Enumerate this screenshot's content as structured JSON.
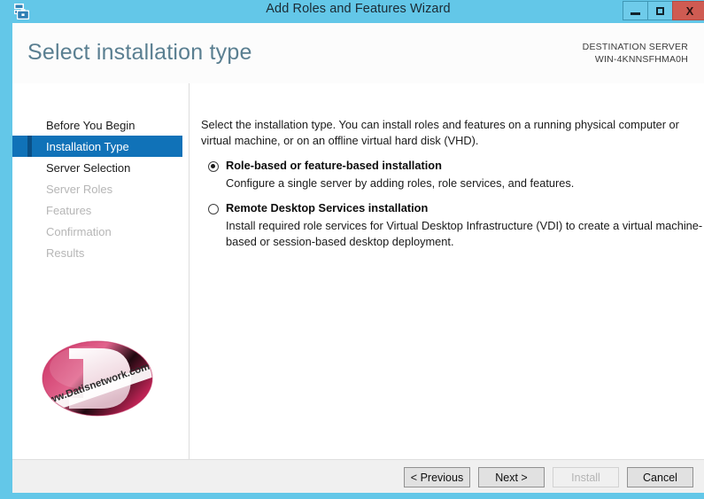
{
  "window": {
    "title": "Add Roles and Features Wizard",
    "app_icon": "server-manager-toolbox-icon",
    "minimize_label": "",
    "maximize_label": "",
    "close_label": "X",
    "frame_color": "#63c7e8",
    "close_color": "#cf5b52"
  },
  "header": {
    "page_title": "Select installation type",
    "destination_label": "DESTINATION SERVER",
    "destination_server": "WIN-4KNNSFHMA0H"
  },
  "sidebar": {
    "accent_color": "#1072b8",
    "items": [
      {
        "label": "Before You Begin",
        "state": "enabled"
      },
      {
        "label": "Installation Type",
        "state": "selected"
      },
      {
        "label": "Server Selection",
        "state": "enabled"
      },
      {
        "label": "Server Roles",
        "state": "disabled"
      },
      {
        "label": "Features",
        "state": "disabled"
      },
      {
        "label": "Confirmation",
        "state": "disabled"
      },
      {
        "label": "Results",
        "state": "disabled"
      }
    ],
    "logo": {
      "name": "datisnetwork-logo",
      "letter": "D",
      "banner_text": "www.Datisnetwork.com",
      "color": "#d6386b"
    }
  },
  "main": {
    "intro": "Select the installation type. You can install roles and features on a running physical computer or virtual machine, or on an offline virtual hard disk (VHD).",
    "options": [
      {
        "label": "Role-based or feature-based installation",
        "description": "Configure a single server by adding roles, role services, and features.",
        "selected": true
      },
      {
        "label": "Remote Desktop Services installation",
        "description": "Install required role services for Virtual Desktop Infrastructure (VDI) to create a virtual machine-based or session-based desktop deployment.",
        "selected": false
      }
    ]
  },
  "footer": {
    "buttons": [
      {
        "label": "< Previous",
        "enabled": true
      },
      {
        "label": "Next >",
        "enabled": true
      },
      {
        "label": "Install",
        "enabled": false
      },
      {
        "label": "Cancel",
        "enabled": true
      }
    ]
  }
}
